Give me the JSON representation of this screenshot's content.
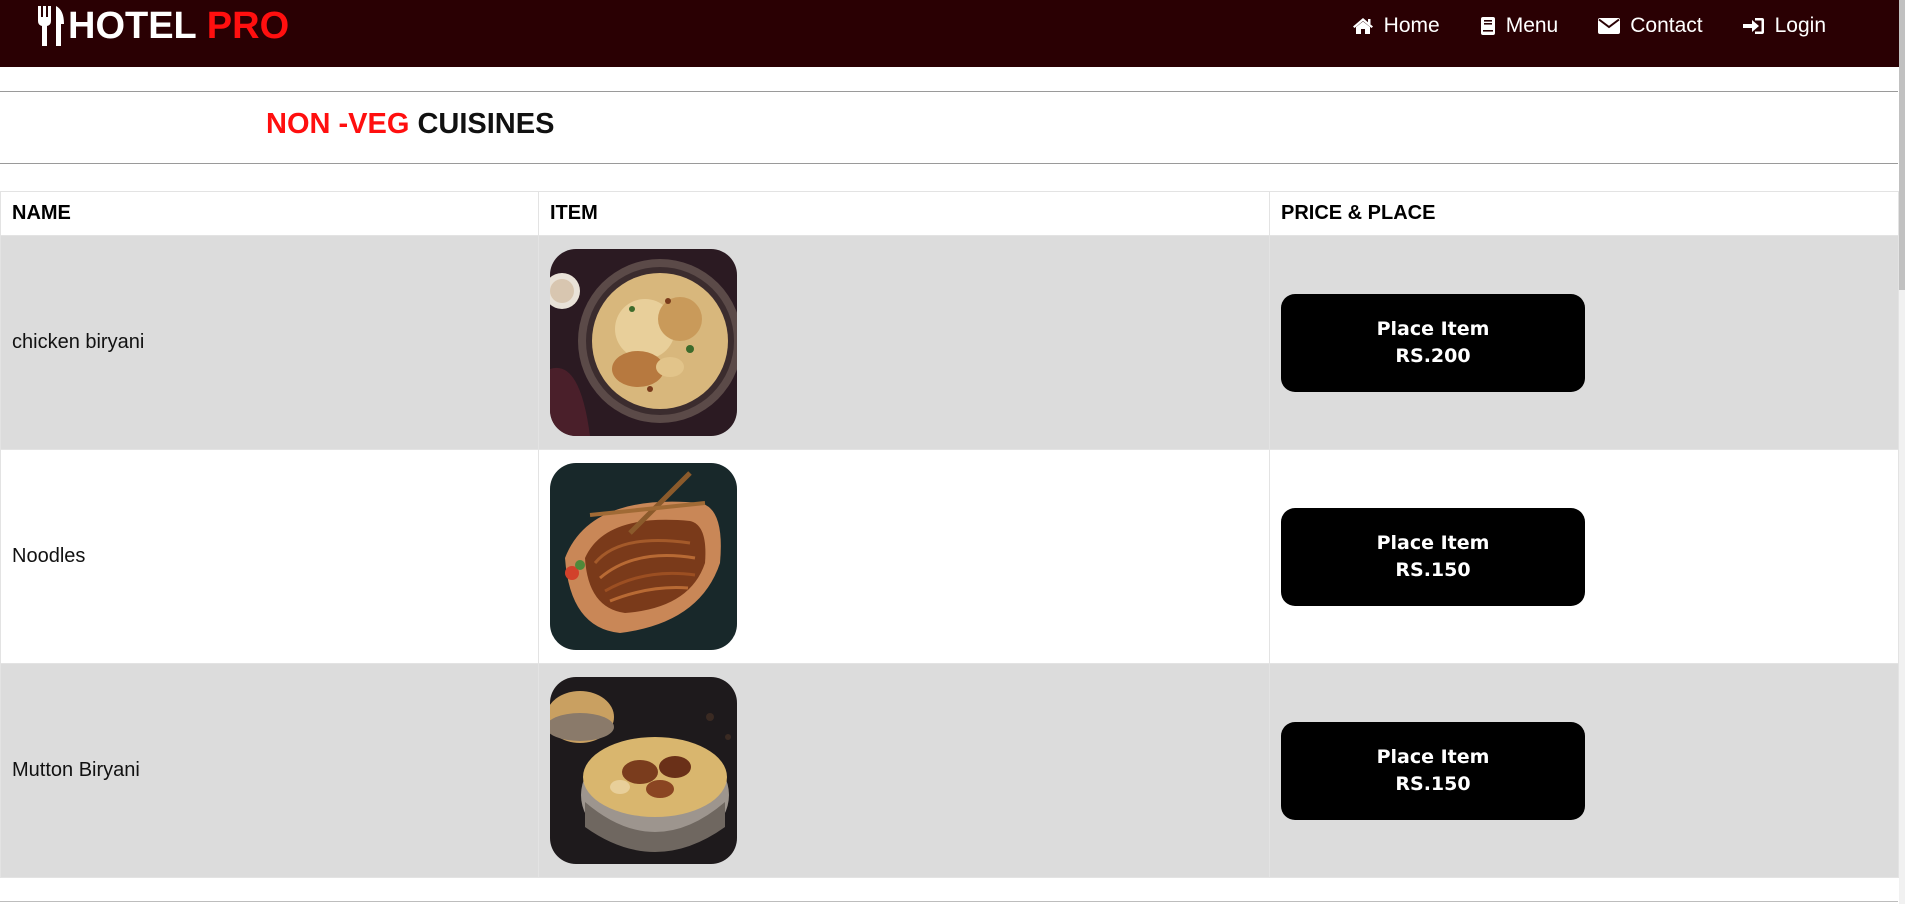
{
  "brand": {
    "name": "HOTEL",
    "accent": "PRO",
    "logo_icon": "utensils-icon"
  },
  "nav": {
    "items": [
      {
        "label": "Home",
        "icon": "home-icon"
      },
      {
        "label": "Menu",
        "icon": "book-icon"
      },
      {
        "label": "Contact",
        "icon": "envelope-icon"
      },
      {
        "label": "Login",
        "icon": "sign-in-icon"
      }
    ]
  },
  "section": {
    "title_red": "NON -VEG",
    "title_rest": "CUISINES"
  },
  "table": {
    "headers": [
      "NAME",
      "ITEM",
      "PRICE & PLACE"
    ],
    "rows": [
      {
        "name": "chicken biryani",
        "image": "chicken-biryani-image",
        "button_label": "Place Item",
        "price": "RS.200"
      },
      {
        "name": "Noodles",
        "image": "noodles-image",
        "button_label": "Place Item",
        "price": "RS.150"
      },
      {
        "name": "Mutton Biryani",
        "image": "mutton-biryani-image",
        "button_label": "Place Item",
        "price": "RS.150"
      }
    ]
  },
  "colors": {
    "navbar_bg": "#2a0003",
    "accent_red": "#ff0f0f",
    "row_shade": "#dcdcdc",
    "button_bg": "#000000"
  }
}
